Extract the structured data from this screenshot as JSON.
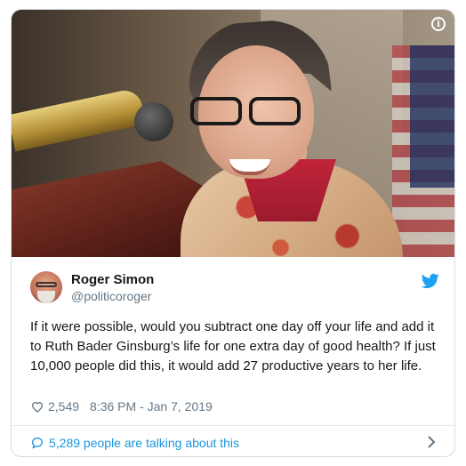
{
  "tweet": {
    "author": {
      "name": "Roger Simon",
      "handle": "@politicoroger"
    },
    "text": "If it were possible, would you subtract one day off your life and add it to Ruth Bader Ginsburg’s life for one extra day of good health? If just 10,000 people did this, it would add 27 productive years to her life.",
    "likes": "2,549",
    "timestamp": "8:36 PM - Jan 7, 2019",
    "talking": "5,289 people are talking about this"
  },
  "icons": {
    "info": "info-icon",
    "twitter": "twitter-bird-icon",
    "like": "heart-icon",
    "comment": "speech-bubble-icon",
    "expand": "chevron-right-icon"
  },
  "colors": {
    "brand": "#1da1f2",
    "link": "#1b95e0",
    "muted": "#657786",
    "text": "#14171a",
    "border": "#e1e8ed"
  }
}
